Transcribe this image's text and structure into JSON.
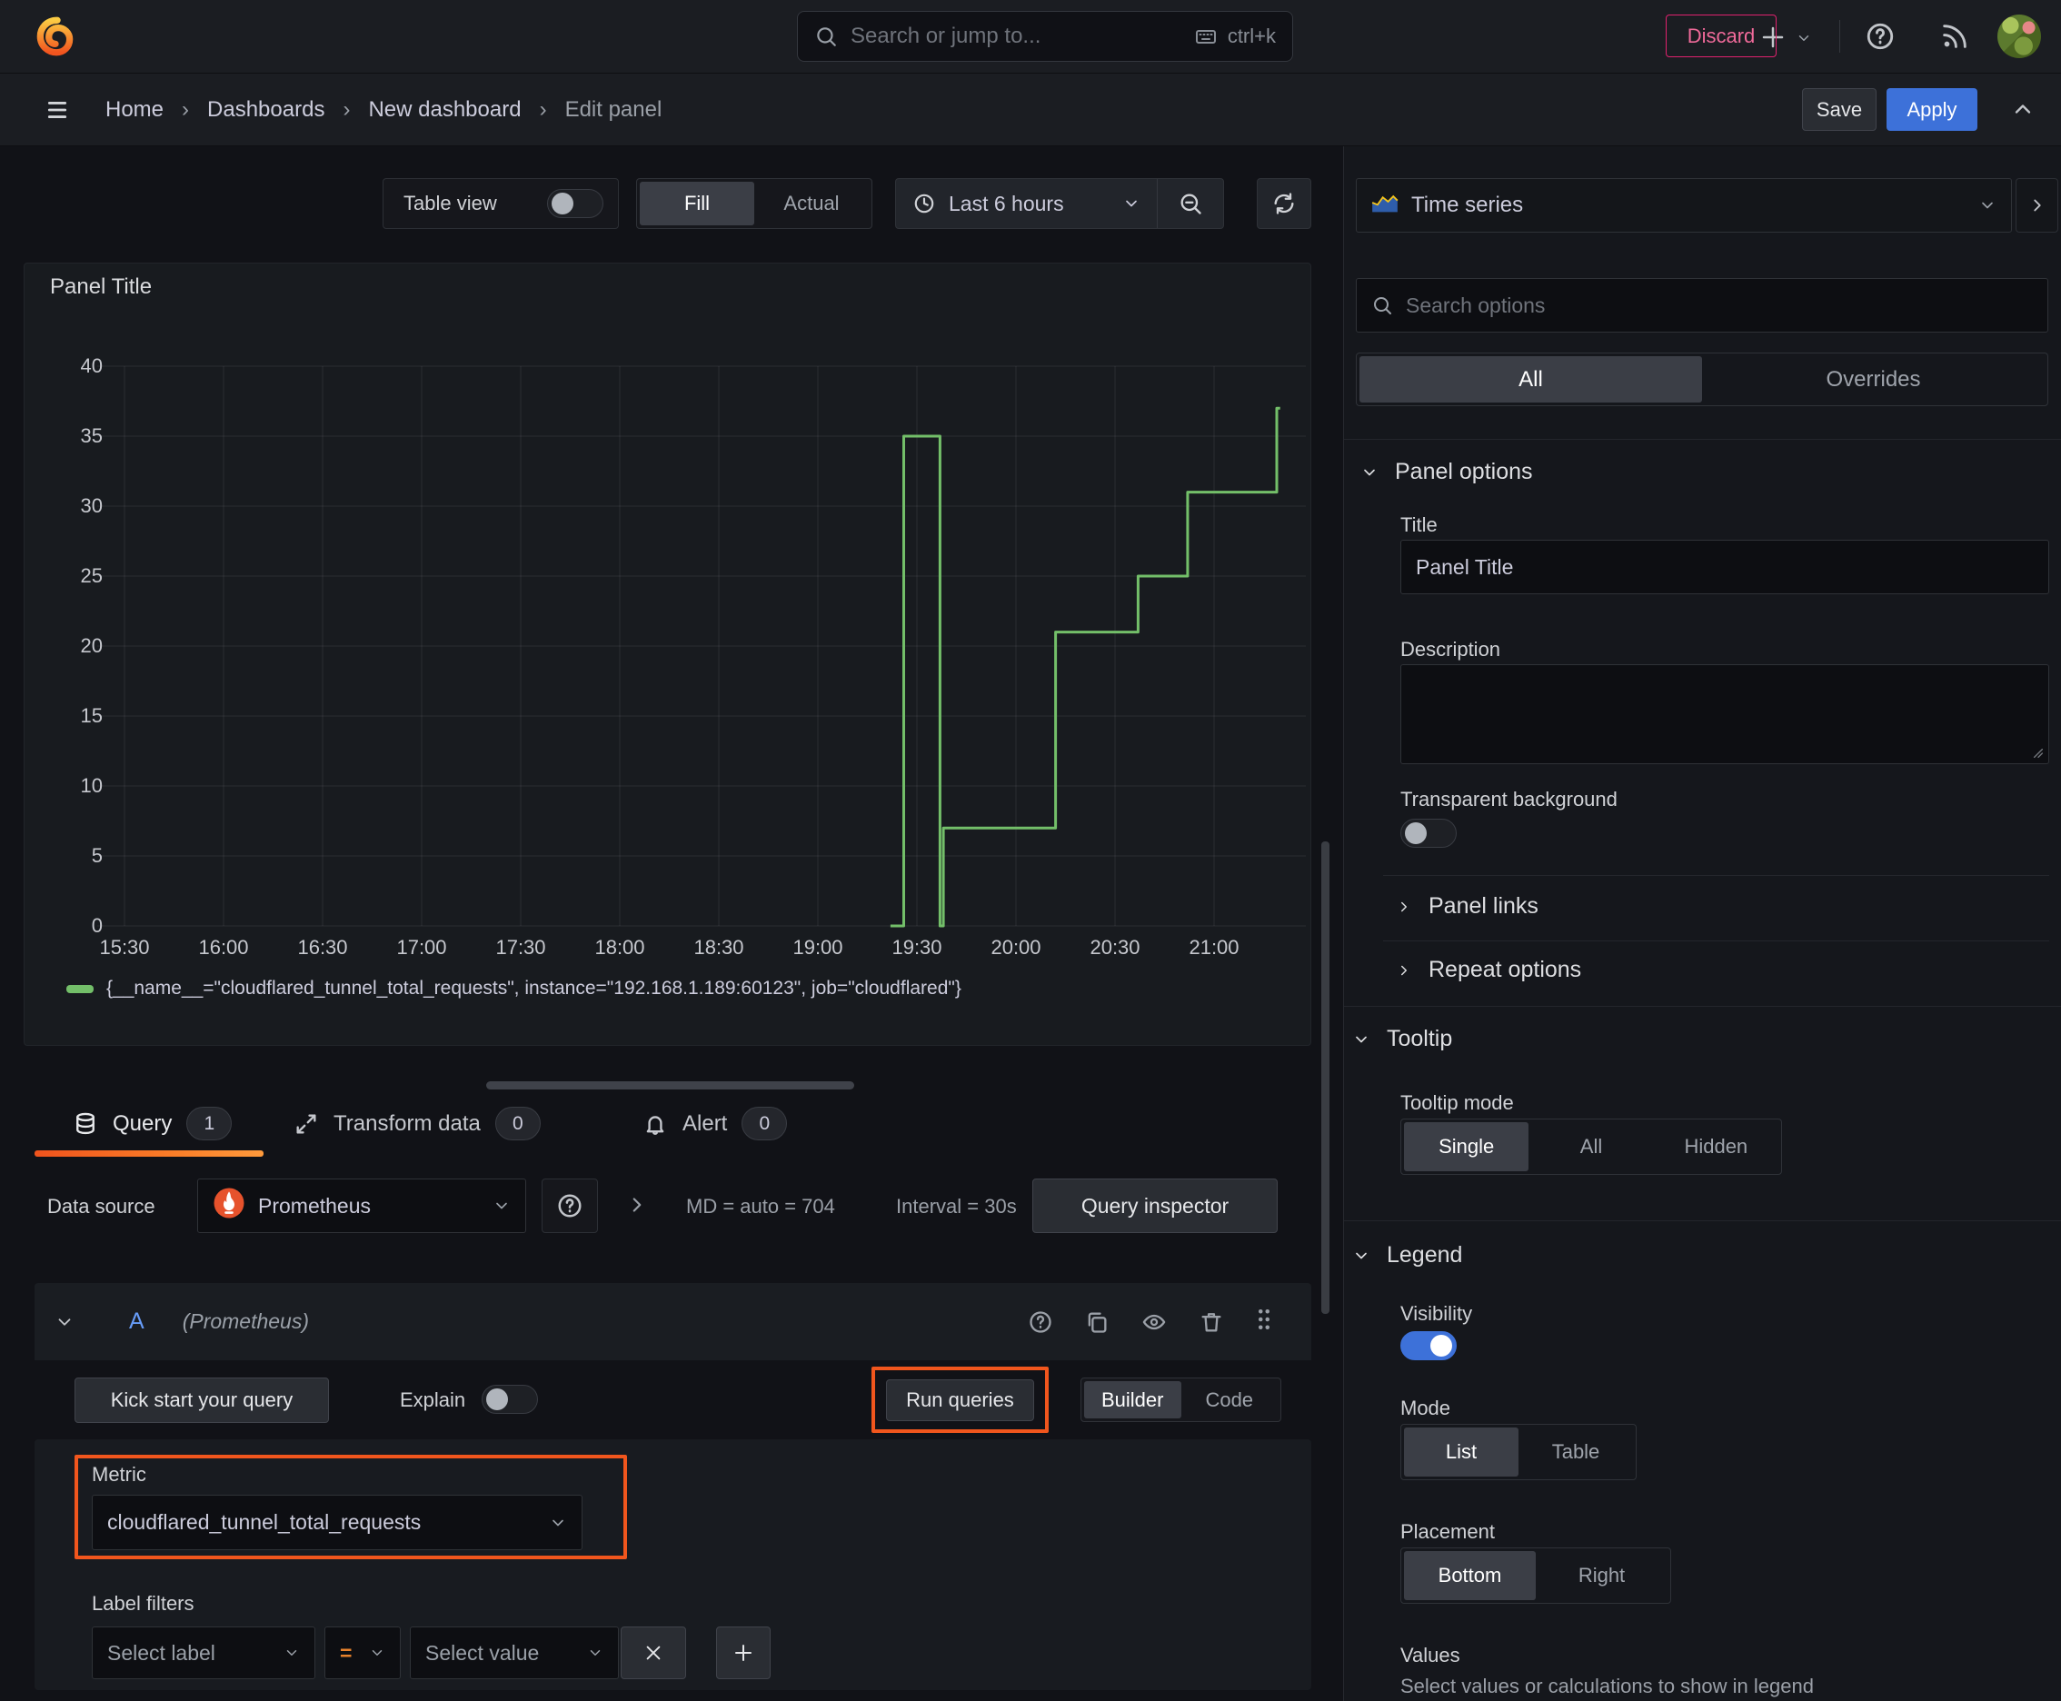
{
  "topnav": {
    "search_placeholder": "Search or jump to...",
    "shortcut": "ctrl+k"
  },
  "breadcrumb": {
    "items": [
      "Home",
      "Dashboards",
      "New dashboard",
      "Edit panel"
    ]
  },
  "header_actions": {
    "discard": "Discard",
    "save": "Save",
    "apply": "Apply"
  },
  "toolbar": {
    "table_view": "Table view",
    "fill": "Fill",
    "actual": "Actual",
    "time_range": "Last 6 hours"
  },
  "panel": {
    "title": "Panel Title"
  },
  "chart_data": {
    "type": "line",
    "title": "Panel Title",
    "xlabel": "",
    "ylabel": "",
    "ylim": [
      0,
      40
    ],
    "y_ticks": [
      0,
      5,
      10,
      15,
      20,
      25,
      30,
      35,
      40
    ],
    "x_ticks": [
      "15:30",
      "16:00",
      "16:30",
      "17:00",
      "17:30",
      "18:00",
      "18:30",
      "19:00",
      "19:30",
      "20:00",
      "20:30",
      "21:00"
    ],
    "minutes_per_tick": 30,
    "grid": true,
    "legend_position": "bottom",
    "series": [
      {
        "name": "{__name__=\"cloudflared_tunnel_total_requests\", instance=\"192.168.1.189:60123\", job=\"cloudflared\"}",
        "color": "#73bf69",
        "points_minutes_value": [
          [
            232,
            0
          ],
          [
            236,
            0
          ],
          [
            236,
            35
          ],
          [
            247,
            35
          ],
          [
            247,
            0
          ],
          [
            248,
            0
          ],
          [
            248,
            7
          ],
          [
            282,
            7
          ],
          [
            282,
            21
          ],
          [
            307,
            21
          ],
          [
            307,
            25
          ],
          [
            322,
            25
          ],
          [
            322,
            31
          ],
          [
            349,
            31
          ],
          [
            349,
            37
          ],
          [
            350,
            37
          ]
        ]
      }
    ]
  },
  "tabs": {
    "query": "Query",
    "query_count": "1",
    "transform": "Transform data",
    "transform_count": "0",
    "alert": "Alert",
    "alert_count": "0"
  },
  "datasource": {
    "label": "Data source",
    "name": "Prometheus",
    "stats_md": "MD = auto = 704",
    "stats_interval": "Interval = 30s",
    "query_inspector": "Query inspector"
  },
  "query_editor": {
    "ref_id": "A",
    "ds_hint": "(Prometheus)",
    "kick_start": "Kick start your query",
    "explain": "Explain",
    "run_queries": "Run queries",
    "builder": "Builder",
    "code": "Code",
    "metric_label": "Metric",
    "metric_value": "cloudflared_tunnel_total_requests",
    "label_filters": "Label filters",
    "select_label": "Select label",
    "operator": "=",
    "select_value": "Select value"
  },
  "options": {
    "viz_name": "Time series",
    "search_placeholder": "Search options",
    "tab_all": "All",
    "tab_overrides": "Overrides",
    "panel_options": {
      "title": "Panel options",
      "title_label": "Title",
      "title_value": "Panel Title",
      "description_label": "Description",
      "transparent_label": "Transparent background"
    },
    "links": "Panel links",
    "repeat": "Repeat options",
    "tooltip": {
      "title": "Tooltip",
      "mode_label": "Tooltip mode",
      "modes": [
        "Single",
        "All",
        "Hidden"
      ]
    },
    "legend": {
      "title": "Legend",
      "visibility": "Visibility",
      "mode_label": "Mode",
      "modes": [
        "List",
        "Table"
      ],
      "placement_label": "Placement",
      "placements": [
        "Bottom",
        "Right"
      ],
      "values_label": "Values",
      "values_hint": "Select values or calculations to show in legend"
    }
  },
  "colors": {
    "accent_blue": "#3d71d9",
    "annotation_orange": "#f1561d",
    "tab_underline_from": "#f0531d",
    "tab_underline_to": "#ff9a3c",
    "series_green": "#73bf69",
    "danger_pink": "#e0226e",
    "prometheus_orange": "#e6522c"
  }
}
